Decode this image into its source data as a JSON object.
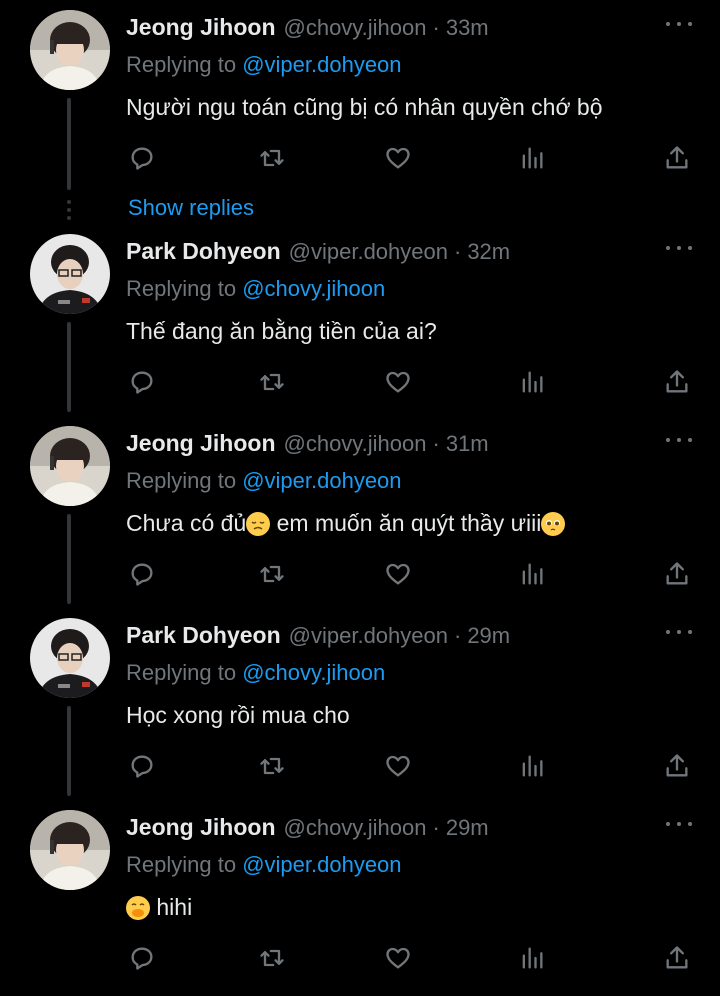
{
  "colors": {
    "background": "#000000",
    "primary_text": "#e7e9ea",
    "secondary_text": "#71767b",
    "link": "#1d9bf0",
    "thread_line": "#333639"
  },
  "show_replies": "Show replies",
  "tweets": [
    {
      "name": "Jeong Jihoon",
      "handle": "@chovy.jihoon",
      "separator": "·",
      "time": "33m",
      "replying_prefix": "Replying to",
      "replying_to": "@viper.dohyeon",
      "text": "Người ngu toán cũng bị có nhân quyền chớ bộ",
      "avatar": "avatar-jihoon"
    },
    {
      "name": "Park Dohyeon",
      "handle": "@viper.dohyeon",
      "separator": "·",
      "time": "32m",
      "replying_prefix": "Replying to",
      "replying_to": "@chovy.jihoon",
      "text": "Thế đang ăn bằng tiền của ai?",
      "avatar": "avatar-dohyeon"
    },
    {
      "name": "Jeong Jihoon",
      "handle": "@chovy.jihoon",
      "separator": "·",
      "time": "31m",
      "replying_prefix": "Replying to",
      "replying_to": "@viper.dohyeon",
      "text_part1": "Chưa có đủ",
      "emoji1": "disappointed-face",
      "text_part2": " em muốn ăn quýt thầy ưiii",
      "emoji2": "pleading-face",
      "avatar": "avatar-jihoon"
    },
    {
      "name": "Park Dohyeon",
      "handle": "@viper.dohyeon",
      "separator": "·",
      "time": "29m",
      "replying_prefix": "Replying to",
      "replying_to": "@chovy.jihoon",
      "text": "Học xong rồi mua cho",
      "avatar": "avatar-dohyeon"
    },
    {
      "name": "Jeong Jihoon",
      "handle": "@chovy.jihoon",
      "separator": "·",
      "time": "29m",
      "replying_prefix": "Replying to",
      "replying_to": "@viper.dohyeon",
      "emoji": "face-with-hand-over-mouth",
      "text": " hihi",
      "avatar": "avatar-jihoon"
    }
  ],
  "action_icons": [
    "reply-icon",
    "retweet-icon",
    "like-icon",
    "views-icon",
    "share-icon"
  ]
}
